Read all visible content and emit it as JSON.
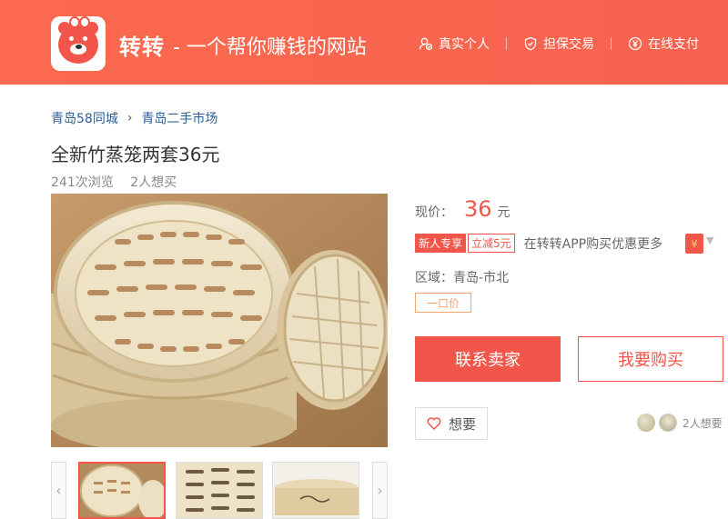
{
  "header": {
    "brand": "转转",
    "slogan": "- 一个帮你赚钱的网站",
    "features": [
      {
        "icon": "user-verify-icon",
        "label": "真实个人"
      },
      {
        "icon": "shield-icon",
        "label": "担保交易"
      },
      {
        "icon": "yen-circle-icon",
        "label": "在线支付"
      }
    ]
  },
  "breadcrumb": [
    "青岛58同城",
    "青岛二手市场"
  ],
  "product": {
    "title": "全新竹蒸笼两套36元",
    "views": "241次浏览",
    "wants": "2人想买",
    "price_label": "现价：",
    "price": "36",
    "price_unit": "元",
    "promo_new": "新人专享",
    "promo_cut": "立减5元",
    "promo_text": "在转转APP购买优惠更多",
    "redpacket": "¥",
    "region": "区域：青岛-市北",
    "price_tag": "一口价"
  },
  "actions": {
    "contact": "联系卖家",
    "buy": "我要购买",
    "want": "想要",
    "wanters_count": "2人想要"
  },
  "thumbs": {
    "prev": "‹",
    "next": "›"
  },
  "colors": {
    "accent": "#f2564a",
    "header": "#fb6a4f",
    "link": "#2b5e9c"
  }
}
